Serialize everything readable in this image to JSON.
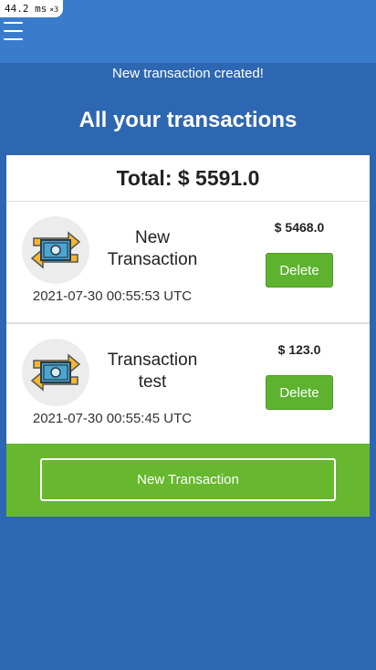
{
  "perf": {
    "value": "44.2",
    "unit": "ms",
    "multiplier": "×3"
  },
  "flash": "New transaction created!",
  "title": "All your transactions",
  "total": "Total: $ 5591.0",
  "transactions": [
    {
      "name": "New Transaction",
      "amount": "$ 5468.0",
      "date": "2021-07-30 00:55:53 UTC",
      "delete_label": "Delete"
    },
    {
      "name": "Transaction test",
      "amount": "$ 123.0",
      "date": "2021-07-30 00:55:45 UTC",
      "delete_label": "Delete"
    }
  ],
  "new_button_label": "New Transaction",
  "colors": {
    "header": "#3a7ccc",
    "background": "#2e67b1",
    "accent_green": "#5db22e"
  },
  "icons": {
    "menu": "hamburger-menu-icon",
    "transaction": "money-exchange-icon"
  }
}
